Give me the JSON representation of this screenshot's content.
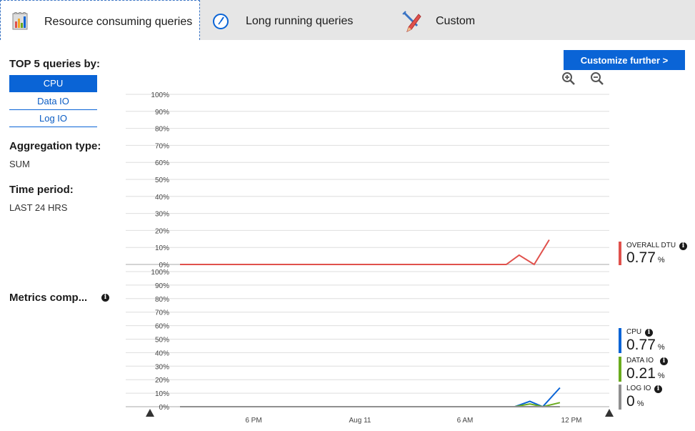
{
  "tabs": [
    {
      "label": "Resource consuming queries",
      "icon": "resource-chart-icon",
      "active": true
    },
    {
      "label": "Long running queries",
      "icon": "clock-icon",
      "active": false
    },
    {
      "label": "Custom",
      "icon": "custom-tools-icon",
      "active": false
    }
  ],
  "left_panel": {
    "top_queries_label": "TOP 5 queries by:",
    "metric_options": [
      "CPU",
      "Data IO",
      "Log IO"
    ],
    "selected_metric": "CPU",
    "aggregation_label": "Aggregation type:",
    "aggregation_value": "SUM",
    "time_period_label": "Time period:",
    "time_period_value": "LAST 24 HRS",
    "metrics_label": "Metrics comp..."
  },
  "toolbar": {
    "customize_label": "Customize further >"
  },
  "colors": {
    "accent": "#0a64d6",
    "overall_dtu": "#e0514c",
    "cpu": "#0a64d6",
    "data_io": "#6aab1e",
    "log_io": "#8f8f8f"
  },
  "chart_data": [
    {
      "type": "line",
      "title": "",
      "y_ticks": [
        "100%",
        "90%",
        "80%",
        "70%",
        "60%",
        "50%",
        "40%",
        "30%",
        "20%",
        "10%",
        "0%"
      ],
      "ylim": [
        0,
        100
      ],
      "grid": true,
      "x_ticks": [],
      "series": [
        {
          "name": "OVERALL DTU",
          "color": "#e0514c",
          "points": [
            [
              0,
              0
            ],
            [
              0.76,
              0
            ],
            [
              0.79,
              5.5
            ],
            [
              0.825,
              0
            ],
            [
              0.86,
              14.5
            ]
          ]
        }
      ],
      "legend": [
        {
          "name": "OVERALL DTU",
          "value": "0.77",
          "unit": "%"
        }
      ]
    },
    {
      "type": "line",
      "title": "",
      "y_ticks": [
        "100%",
        "90%",
        "80%",
        "70%",
        "60%",
        "50%",
        "40%",
        "30%",
        "20%",
        "10%",
        "0%"
      ],
      "ylim": [
        0,
        100
      ],
      "grid": true,
      "x_ticks": [
        "6 PM",
        "Aug 11",
        "6 AM",
        "12 PM"
      ],
      "series": [
        {
          "name": "CPU",
          "color": "#0a64d6",
          "points": [
            [
              0,
              0
            ],
            [
              0.78,
              0
            ],
            [
              0.815,
              4
            ],
            [
              0.845,
              0
            ],
            [
              0.885,
              14
            ]
          ]
        },
        {
          "name": "DATA IO",
          "color": "#6aab1e",
          "points": [
            [
              0,
              0
            ],
            [
              0.78,
              0
            ],
            [
              0.815,
              2
            ],
            [
              0.845,
              0
            ],
            [
              0.885,
              3
            ]
          ]
        },
        {
          "name": "LOG IO",
          "color": "#8f8f8f",
          "points": [
            [
              0,
              0
            ],
            [
              0.885,
              0
            ]
          ]
        }
      ],
      "legend": [
        {
          "name": "CPU",
          "value": "0.77",
          "unit": "%"
        },
        {
          "name": "DATA IO",
          "value": "0.21",
          "unit": "%"
        },
        {
          "name": "LOG IO",
          "value": "0",
          "unit": "%"
        }
      ]
    }
  ]
}
